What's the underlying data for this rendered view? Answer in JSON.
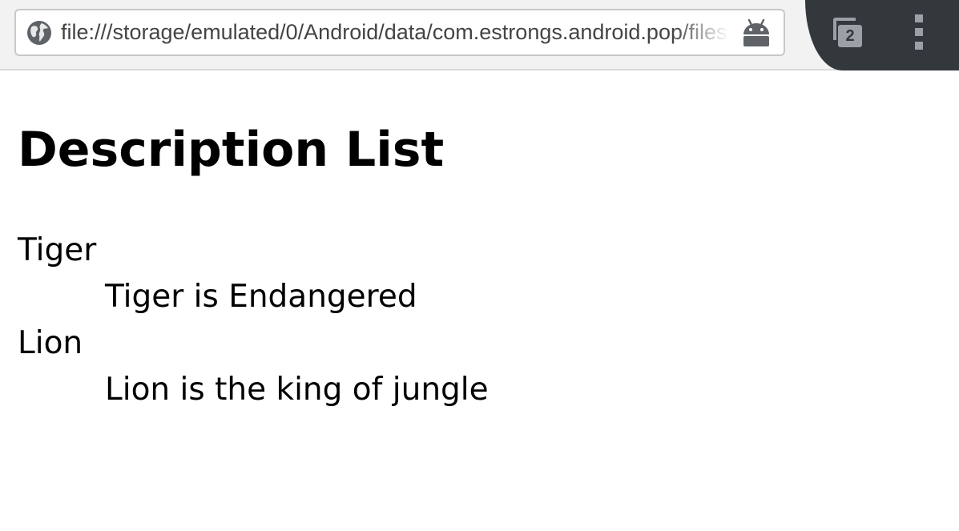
{
  "browser": {
    "url": "file:///storage/emulated/0/Android/data/com.estrongs.android.pop/files/",
    "tab_count": "2",
    "page_info_icon": "globe-icon",
    "debug_icon": "android-icon",
    "tabs_icon": "tab-switcher-icon",
    "menu_icon": "more-vert-icon",
    "colors": {
      "toolbar_dark": "#33383d",
      "toolbar_light": "#f2f2f2"
    }
  },
  "page": {
    "heading": "Description List",
    "items": [
      {
        "term": "Tiger",
        "description": "Tiger is Endangered"
      },
      {
        "term": "Lion",
        "description": "Lion is the king of jungle"
      }
    ]
  }
}
